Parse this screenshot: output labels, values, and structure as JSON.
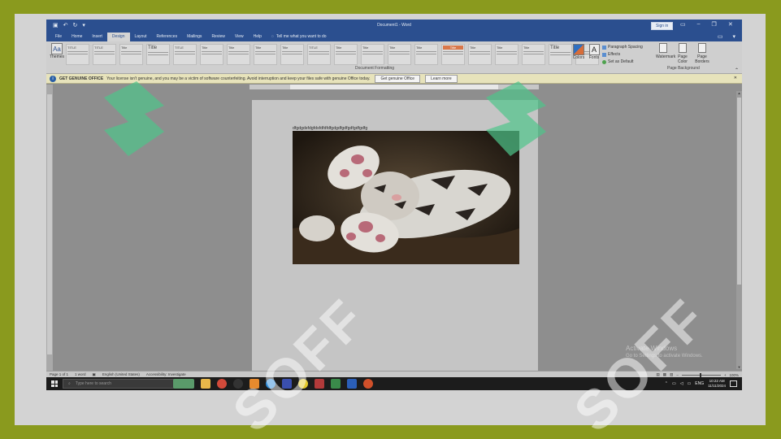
{
  "titlebar": {
    "document_title": "Document1  -  Word",
    "sign_in": "Sign in",
    "qat_icons": [
      "save-icon",
      "undo-icon",
      "redo-icon",
      "customize-icon"
    ],
    "window_icons": [
      "ribbon-display-icon",
      "minimize-icon",
      "restore-icon",
      "close-icon"
    ]
  },
  "tabs": [
    "File",
    "Home",
    "Insert",
    "Design",
    "Layout",
    "References",
    "Mailings",
    "Review",
    "View",
    "Help"
  ],
  "active_tab": "Design",
  "tell_me": "Tell me what you want to do",
  "ribbon": {
    "themes_label": "Themes",
    "style_gallery": [
      "TITLE",
      "TITLE",
      "Title",
      "Title",
      "TITLE",
      "Title",
      "Title",
      "Title",
      "Title",
      "TITLE",
      "Title",
      "Title",
      "Title",
      "Title",
      "Title",
      "Title",
      "Title",
      "Title",
      "Title",
      "Title",
      "Title"
    ],
    "document_formatting_label": "Document Formatting",
    "colors_label": "Colors",
    "fonts_label": "Fonts",
    "paragraph_spacing": "Paragraph Spacing",
    "effects": "Effects",
    "set_as_default": "Set as Default",
    "watermark": "Watermark",
    "page_color": "Page Color",
    "page_borders": "Page Borders",
    "page_background_label": "Page Background"
  },
  "message_bar": {
    "label": "GET GENUINE OFFICE",
    "message": "Your license isn't genuine, and you may be a victim of software counterfeiting. Avoid interruption and keep your files safe with genuine Office today.",
    "button_get": "Get genuine Office",
    "button_learn": "Learn more"
  },
  "document": {
    "text": "dfgdgdsfdgfdsfdfdfdfgdgdfgdfgdfgdfgdfg"
  },
  "activate_windows": {
    "title": "Activate Windows",
    "subtitle": "Go to Settings to activate Windows."
  },
  "statusbar": {
    "page": "Page 1 of 1",
    "words": "1 word",
    "language": "English (United States)",
    "accessibility": "Accessibility: Investigate",
    "zoom": "100%"
  },
  "taskbar": {
    "search_placeholder": "Type here to search",
    "language": "ENG",
    "time": "10:22 AM",
    "date": "11/11/2024"
  },
  "watermark": {
    "text": "SOFF"
  },
  "colors": {
    "border_outer": "#8a9a1e",
    "word_blue": "#2b4f8f",
    "message_bar": "#e7e3bb",
    "watermark_green": "#4fc48a"
  }
}
